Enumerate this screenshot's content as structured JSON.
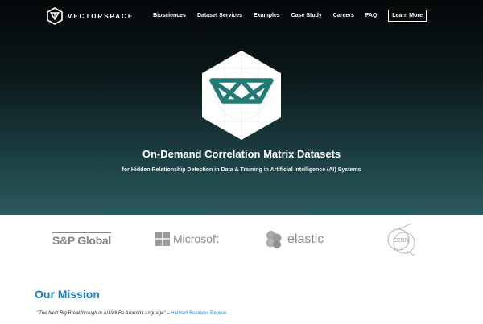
{
  "brand": {
    "name": "VECTORSPACE"
  },
  "nav": {
    "items": [
      "Biosciences",
      "Dataset Services",
      "Examples",
      "Case Study",
      "Careers",
      "FAQ"
    ],
    "cta": "Learn More"
  },
  "hero": {
    "title": "On-Demand Correlation Matrix Datasets",
    "subtitle": "for Hidden Relationship Detection in Data & Training in Artificial Intelligence (AI) Systems"
  },
  "clients": {
    "sp_global": "S&P Global",
    "microsoft": "Microsoft",
    "elastic": "elastic",
    "cern": "CERN"
  },
  "mission": {
    "title": "Our Mission",
    "quote": "\"The Next Big Breakthrough in AI Will Be Around Language\"",
    "separator": " – ",
    "source": "Harvard Business Review"
  },
  "colors": {
    "accent": "#1c7fbf",
    "teal": "#237a74",
    "logo_gray": "#8a8a8a"
  }
}
